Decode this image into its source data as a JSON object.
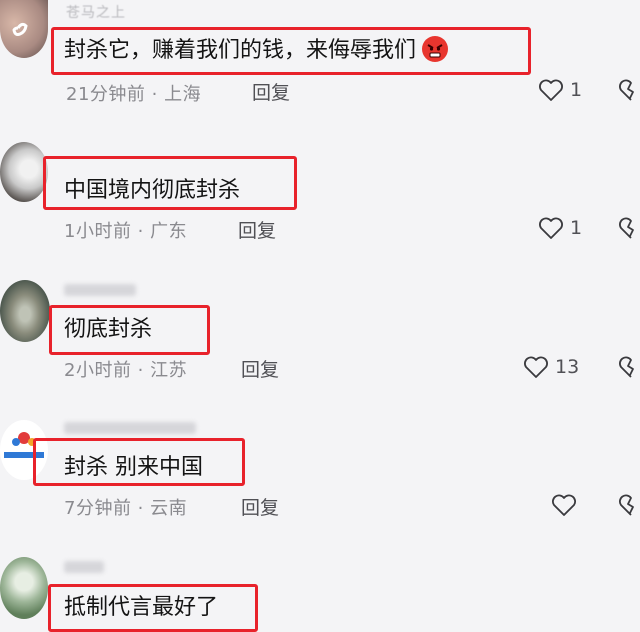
{
  "comments": [
    {
      "username": "苍马之上",
      "text": "封杀它，赚着我们的钱，来侮辱我们",
      "emoji": "angry-face",
      "time": "21分钟前",
      "location": "上海",
      "reply_label": "回复",
      "likes": "1"
    },
    {
      "username": "",
      "text": "中国境内彻底封杀",
      "time": "1小时前",
      "location": "广东",
      "reply_label": "回复",
      "likes": "1"
    },
    {
      "username": "",
      "text": "彻底封杀",
      "time": "2小时前",
      "location": "江苏",
      "reply_label": "回复",
      "likes": "13"
    },
    {
      "username": "",
      "text": "封杀 别来中国",
      "time": "7分钟前",
      "location": "云南",
      "reply_label": "回复",
      "likes": ""
    },
    {
      "username": "",
      "text": "抵制代言最好了"
    }
  ],
  "separator": " · ",
  "colors": {
    "highlight_border": "#e8222b",
    "meta_text": "#8a8a8f",
    "background": "#f4f4f6"
  }
}
